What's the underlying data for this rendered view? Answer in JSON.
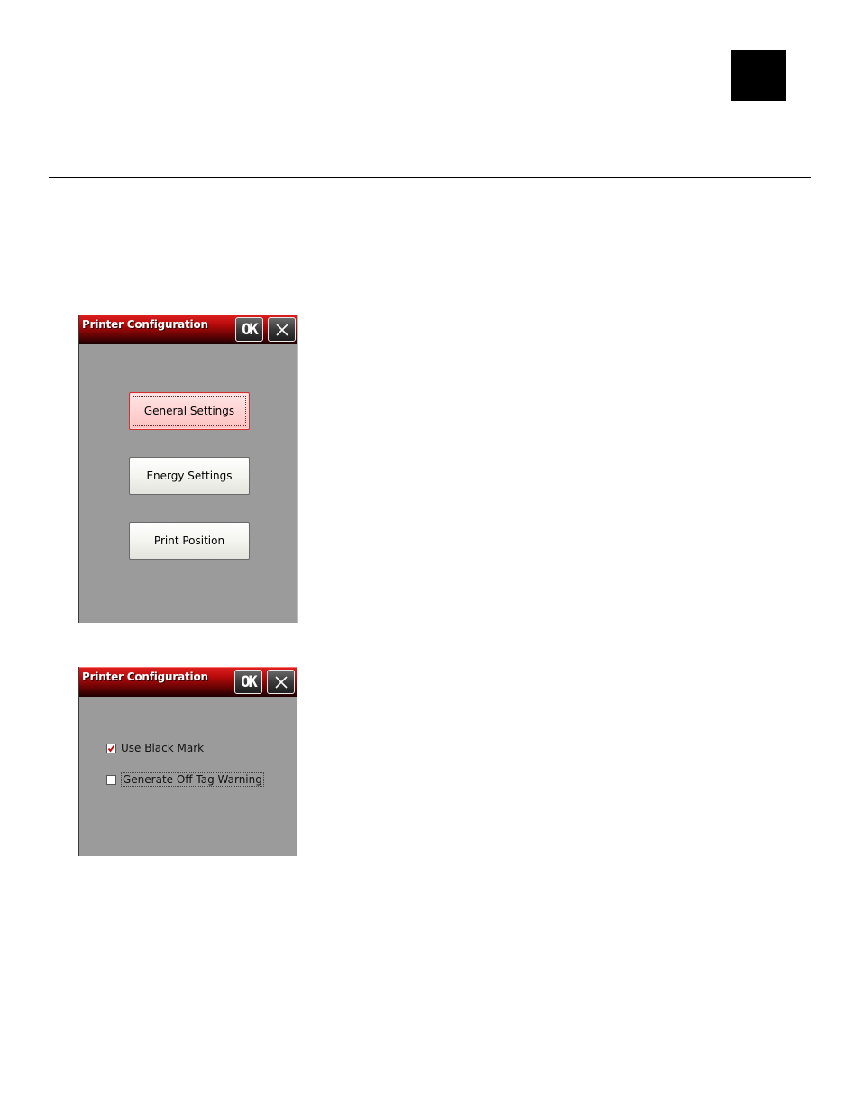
{
  "dialog1": {
    "title": "Printer Configuration",
    "ok_label": "OK",
    "buttons": [
      {
        "label": "General Settings"
      },
      {
        "label": "Energy Settings"
      },
      {
        "label": "Print Position"
      }
    ]
  },
  "dialog2": {
    "title": "Printer Configuration",
    "ok_label": "OK",
    "options": [
      {
        "label": "Use Black Mark",
        "checked": true
      },
      {
        "label": "Generate Off Tag Warning",
        "checked": false
      }
    ]
  },
  "colors": {
    "titlebar_red": "#c41414",
    "dialog_bg": "#9c9b9c",
    "active_button": "#ffd0d0",
    "check_mark": "#c00000"
  }
}
